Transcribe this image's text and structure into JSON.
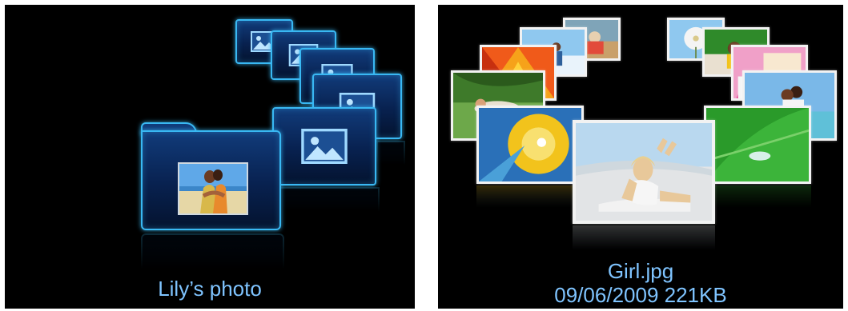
{
  "folder_view": {
    "caption": "Lily’s photo",
    "folders": [
      "photo-folder",
      "photo-folder",
      "photo-folder",
      "photo-folder",
      "photo-folder"
    ]
  },
  "photo_view": {
    "filename": "Girl.jpg",
    "details": "09/06/2009 221KB"
  },
  "colors": {
    "background": "#000000",
    "accent_glow": "#39b8f3",
    "caption_text": "#7fc4ff"
  },
  "icons": [
    "picture-icon",
    "folder-icon"
  ]
}
